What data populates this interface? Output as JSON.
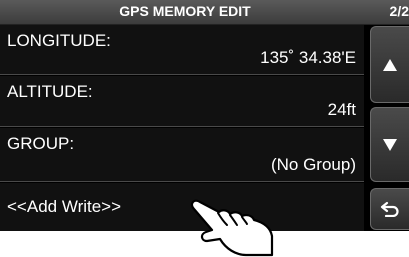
{
  "header": {
    "title": "GPS MEMORY EDIT",
    "page": "2/2"
  },
  "rows": [
    {
      "label": "LONGITUDE:",
      "value": "135˚ 34.38'E"
    },
    {
      "label": "ALTITUDE:",
      "value": "24ft"
    },
    {
      "label": "GROUP:",
      "value": "(No Group)"
    },
    {
      "label": "<<Add Write>>"
    }
  ],
  "side_buttons": {
    "up_icon": "triangle-up-icon",
    "down_icon": "triangle-down-icon",
    "back_icon": "return-arrow-icon"
  },
  "colors": {
    "screen": "#000000",
    "text": "#ffffff",
    "titlebar": "#4a4a4a"
  }
}
